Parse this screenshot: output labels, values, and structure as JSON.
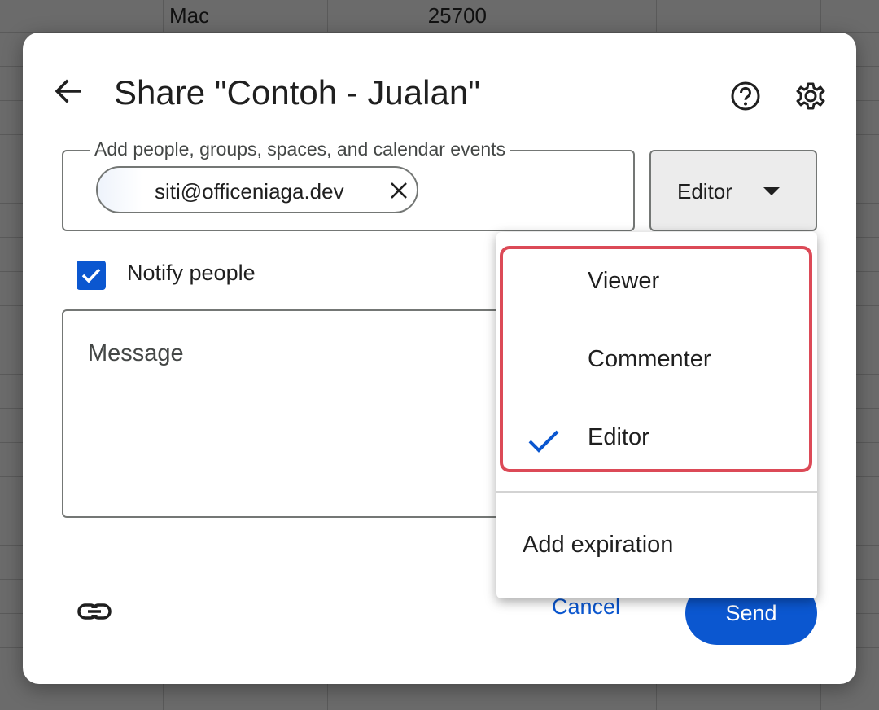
{
  "background_sheet": {
    "cell_a": "Mac",
    "cell_b": "25700"
  },
  "dialog": {
    "title": "Share \"Contoh - Jualan\"",
    "back_icon": "arrow-left-icon",
    "help_icon": "help-circle-icon",
    "settings_icon": "gear-icon"
  },
  "add_people": {
    "label": "Add people, groups, spaces, and calendar events",
    "chips": [
      {
        "email": "siti@officeniaga.dev",
        "remove_icon": "close-icon"
      }
    ]
  },
  "role": {
    "selected": "Editor",
    "caret_icon": "caret-down-icon"
  },
  "notify": {
    "label": "Notify people",
    "checked": true
  },
  "message": {
    "placeholder": "Message"
  },
  "footer": {
    "link_icon": "link-icon",
    "cancel_label": "Cancel",
    "send_label": "Send"
  },
  "role_menu": {
    "items": [
      {
        "label": "Viewer",
        "selected": false
      },
      {
        "label": "Commenter",
        "selected": false
      },
      {
        "label": "Editor",
        "selected": true
      }
    ],
    "extra": "Add expiration",
    "highlight_color": "#dc4a57"
  },
  "colors": {
    "accent": "#0b57d0",
    "overlay": "#6b6b6b"
  }
}
